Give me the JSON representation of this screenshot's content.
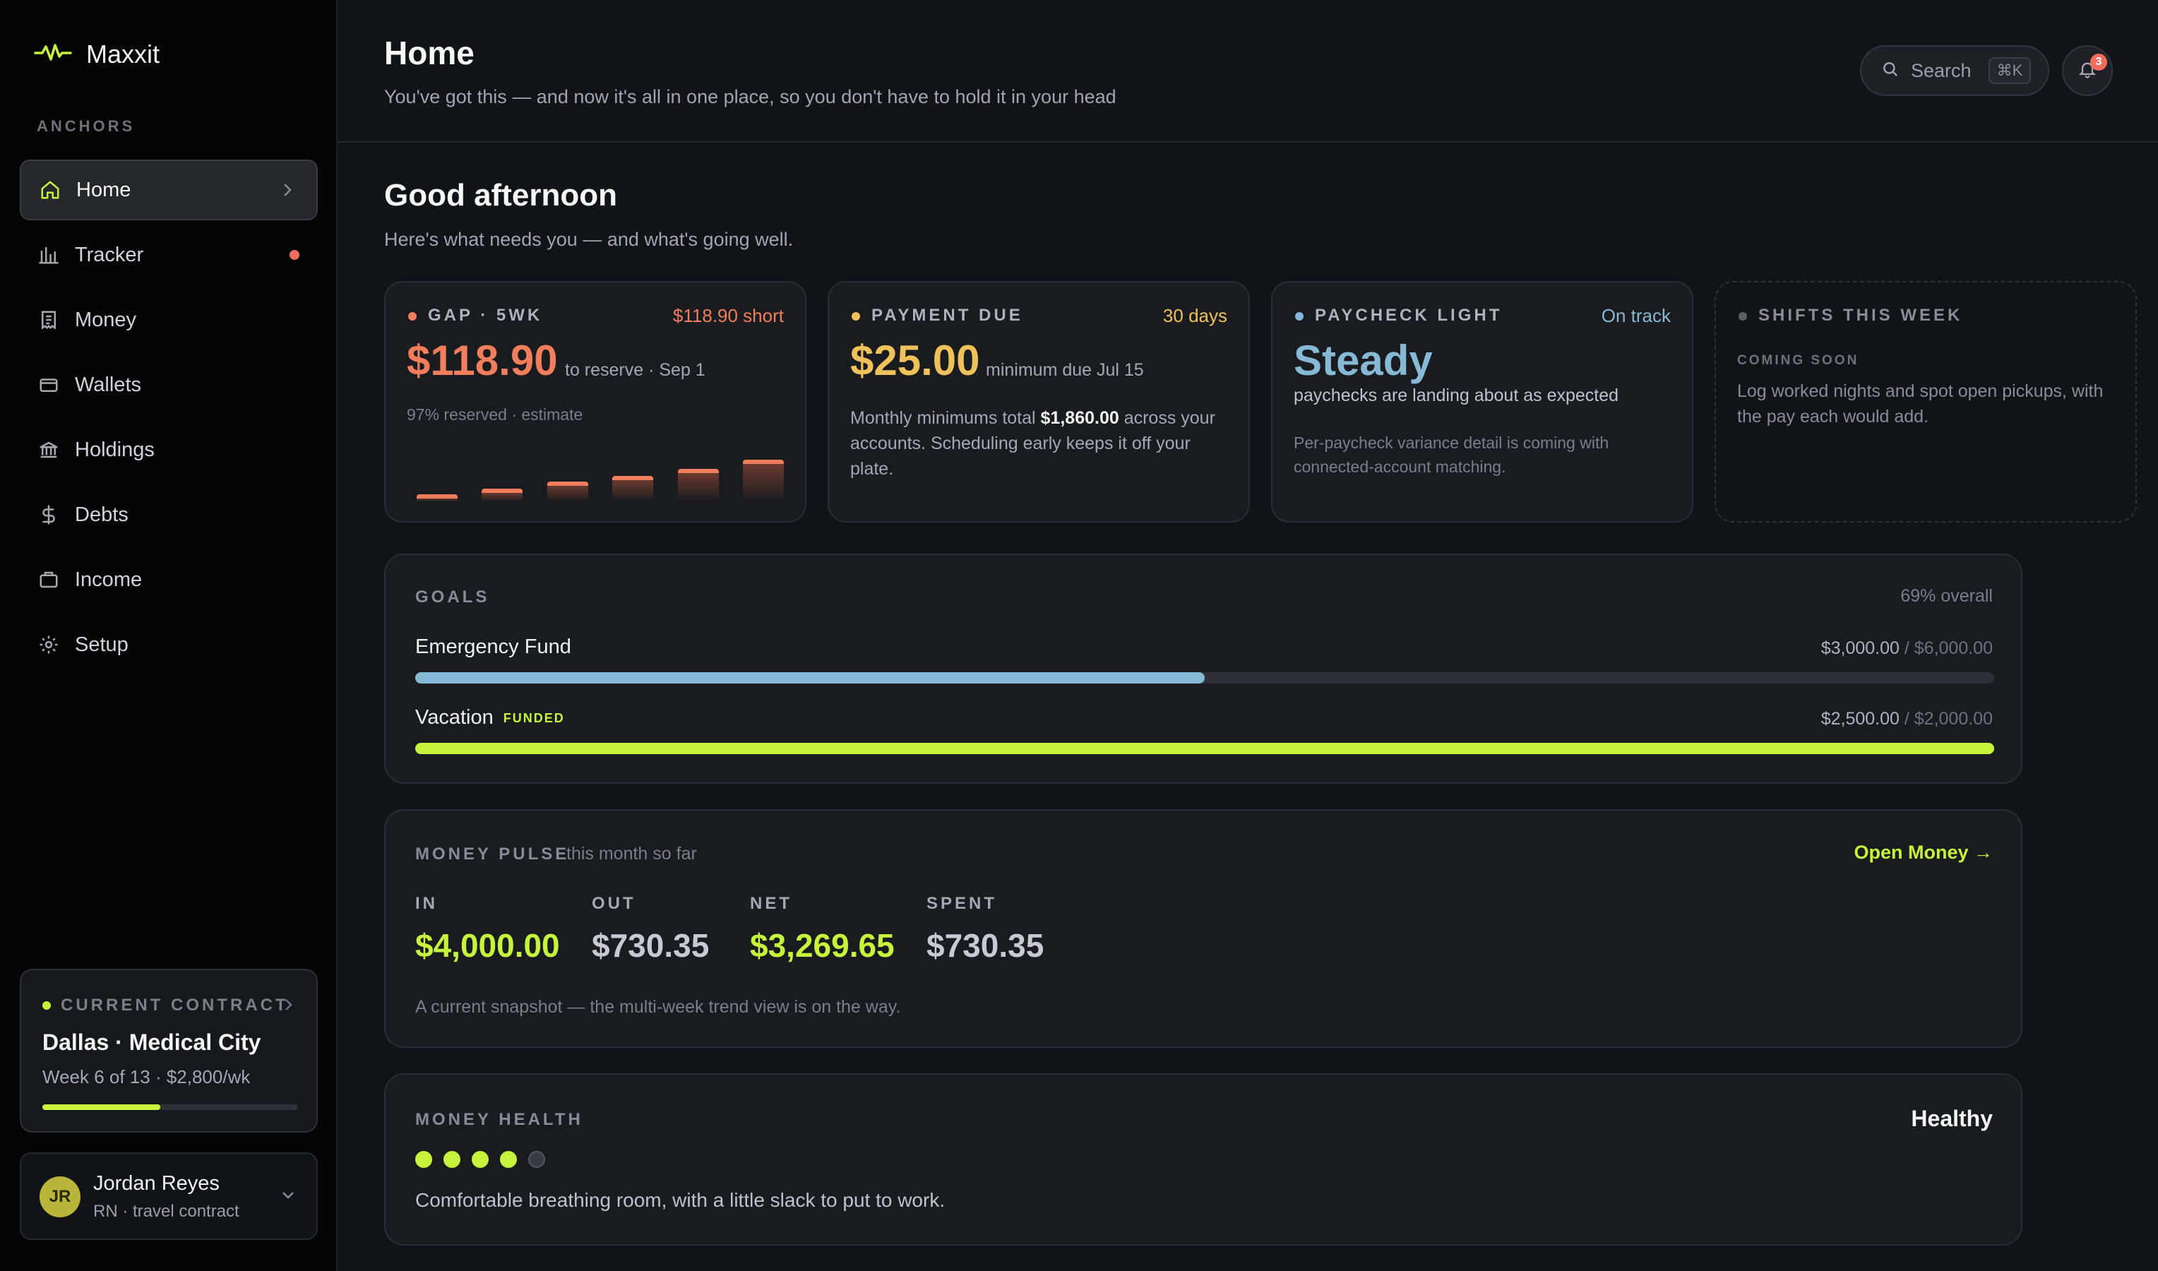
{
  "app": {
    "name": "Maxxit"
  },
  "sidebar": {
    "section_label": "ANCHORS",
    "items": [
      {
        "label": "Home",
        "icon": "home-icon",
        "active": true
      },
      {
        "label": "Tracker",
        "icon": "bar-chart-icon",
        "alert": true
      },
      {
        "label": "Money",
        "icon": "receipt-icon"
      },
      {
        "label": "Wallets",
        "icon": "wallet-icon"
      },
      {
        "label": "Holdings",
        "icon": "bank-icon"
      },
      {
        "label": "Debts",
        "icon": "dollar-icon"
      },
      {
        "label": "Income",
        "icon": "briefcase-icon"
      },
      {
        "label": "Setup",
        "icon": "gear-icon"
      }
    ],
    "contract": {
      "label": "CURRENT CONTRACT",
      "title": "Dallas · Medical City",
      "subtitle": "Week 6 of 13 · $2,800/wk",
      "progress": 0.46
    },
    "user": {
      "initials": "JR",
      "name": "Jordan Reyes",
      "role": "RN · travel contract"
    }
  },
  "header": {
    "title": "Home",
    "subtitle": "You've got this — and now it's all in one place, so you don't have to hold it in your head",
    "search_placeholder": "Search",
    "search_shortcut": "⌘K",
    "notifications": "3"
  },
  "main": {
    "greeting": "Good afternoon",
    "greeting_sub": "Here's what needs you — and what's going well.",
    "cards": {
      "gap": {
        "label": "GAP · 5WK",
        "status": "$118.90 short",
        "amount": "$118.90",
        "amount_note": "to reserve · Sep 1",
        "meta": "97% reserved · estimate",
        "bar_levels": [
          0.12,
          0.22,
          0.34,
          0.44,
          0.56,
          0.72
        ],
        "color": "#f07e5c"
      },
      "payment": {
        "label": "PAYMENT DUE",
        "status": "30 days",
        "amount": "$25.00",
        "amount_note": "minimum due Jul 15",
        "text_pre": "Monthly minimums total ",
        "text_bold": "$1,860.00",
        "text_post": " across your accounts. Scheduling early keeps it off your plate.",
        "color": "#efc15a"
      },
      "paycheck": {
        "label": "PAYCHECK LIGHT",
        "status": "On track",
        "amount": "Steady",
        "amount_note": "paychecks are landing about as expected",
        "detail": "Per-paycheck variance detail is coming with connected-account matching.",
        "color": "#86b9d6"
      },
      "shifts": {
        "label": "SHIFTS THIS WEEK",
        "tag": "COMING SOON",
        "text": "Log worked nights and spot open pickups, with the pay each would add."
      }
    },
    "goals": {
      "label": "GOALS",
      "overall": "69% overall",
      "items": [
        {
          "name": "Emergency Fund",
          "current": "$3,000.00",
          "target": "/ $6,000.00",
          "progress": 0.5,
          "color": "#86b9d6"
        },
        {
          "name": "Vacation",
          "tag": "FUNDED",
          "current": "$2,500.00",
          "target": "/ $2,000.00",
          "progress": 1.0,
          "color": "#c6f33c"
        }
      ]
    },
    "pulse": {
      "label": "MONEY PULSE",
      "period": "this month so far",
      "link": "Open Money →",
      "stats": [
        {
          "label": "IN",
          "value": "$4,000.00",
          "color": "#c6f33c"
        },
        {
          "label": "OUT",
          "value": "$730.35",
          "color": "#c9cacf"
        },
        {
          "label": "NET",
          "value": "$3,269.65",
          "color": "#c6f33c"
        },
        {
          "label": "SPENT",
          "value": "$730.35",
          "color": "#c9cacf"
        }
      ],
      "note": "A current snapshot — the multi-week trend view is on the way."
    },
    "health": {
      "label": "MONEY HEALTH",
      "status": "Healthy",
      "score": 4,
      "max": 5,
      "note": "Comfortable breathing room, with a little slack to put to work."
    }
  },
  "colors": {
    "accent": "#c6f33c",
    "alert": "#f26d5b"
  }
}
